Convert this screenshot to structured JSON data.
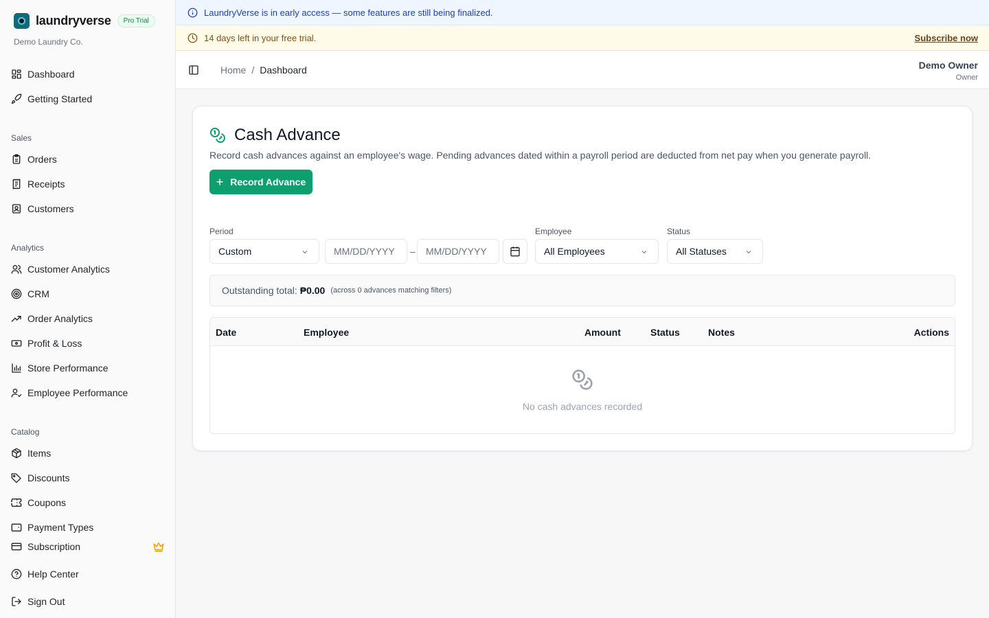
{
  "brand": {
    "name": "laundryverse",
    "badge": "Pro Trial",
    "company": "Demo Laundry Co."
  },
  "sidebar": {
    "top": [
      {
        "label": "Dashboard",
        "icon": "dashboard-icon"
      },
      {
        "label": "Getting Started",
        "icon": "rocket-icon"
      }
    ],
    "groups": [
      {
        "title": "Sales",
        "items": [
          {
            "label": "Orders",
            "icon": "clipboard-icon"
          },
          {
            "label": "Receipts",
            "icon": "receipt-icon"
          },
          {
            "label": "Customers",
            "icon": "contact-icon"
          }
        ]
      },
      {
        "title": "Analytics",
        "items": [
          {
            "label": "Customer Analytics",
            "icon": "users-icon"
          },
          {
            "label": "CRM",
            "icon": "target-icon"
          },
          {
            "label": "Order Analytics",
            "icon": "trending-up-icon"
          },
          {
            "label": "Profit & Loss",
            "icon": "banknote-icon"
          },
          {
            "label": "Store Performance",
            "icon": "bar-chart-icon"
          },
          {
            "label": "Employee Performance",
            "icon": "user-check-icon"
          }
        ]
      },
      {
        "title": "Catalog",
        "items": [
          {
            "label": "Items",
            "icon": "package-icon"
          },
          {
            "label": "Discounts",
            "icon": "tag-icon"
          },
          {
            "label": "Coupons",
            "icon": "ticket-icon"
          },
          {
            "label": "Payment Types",
            "icon": "wallet-icon"
          }
        ]
      }
    ],
    "bottom": [
      {
        "label": "Subscription",
        "icon": "credit-card-icon"
      },
      {
        "label": "Help Center",
        "icon": "help-circle-icon"
      },
      {
        "label": "Sign Out",
        "icon": "log-out-icon"
      }
    ]
  },
  "banners": {
    "info": "LaundryVerse is in early access — some features are still being finalized.",
    "trial": "14 days left in your free trial.",
    "subscribe": "Subscribe now"
  },
  "breadcrumb": {
    "home": "Home",
    "separator": "/",
    "current": "Dashboard"
  },
  "user": {
    "name": "Demo Owner",
    "role": "Owner"
  },
  "page": {
    "title": "Cash Advance",
    "description": "Record cash advances against an employee's wage. Pending advances dated within a payroll period are deducted from net pay when you generate payroll.",
    "record_button": "Record Advance"
  },
  "filters": {
    "period_label": "Period",
    "period_value": "Custom",
    "start_placeholder": "MM/DD/YYYY",
    "end_placeholder": "MM/DD/YYYY",
    "range_dash": "–",
    "employee_label": "Employee",
    "employee_value": "All Employees",
    "status_label": "Status",
    "status_value": "All Statuses"
  },
  "totals": {
    "label": "Outstanding total:",
    "amount": "₱0.00",
    "note": "(across 0 advances matching filters)"
  },
  "table": {
    "columns": {
      "date": "Date",
      "employee": "Employee",
      "amount": "Amount",
      "status": "Status",
      "notes": "Notes",
      "actions": "Actions"
    },
    "empty": "No cash advances recorded"
  },
  "colors": {
    "accent": "#0e9f6e",
    "info_bg": "#eff6ff",
    "trial_bg": "#fefce8"
  }
}
